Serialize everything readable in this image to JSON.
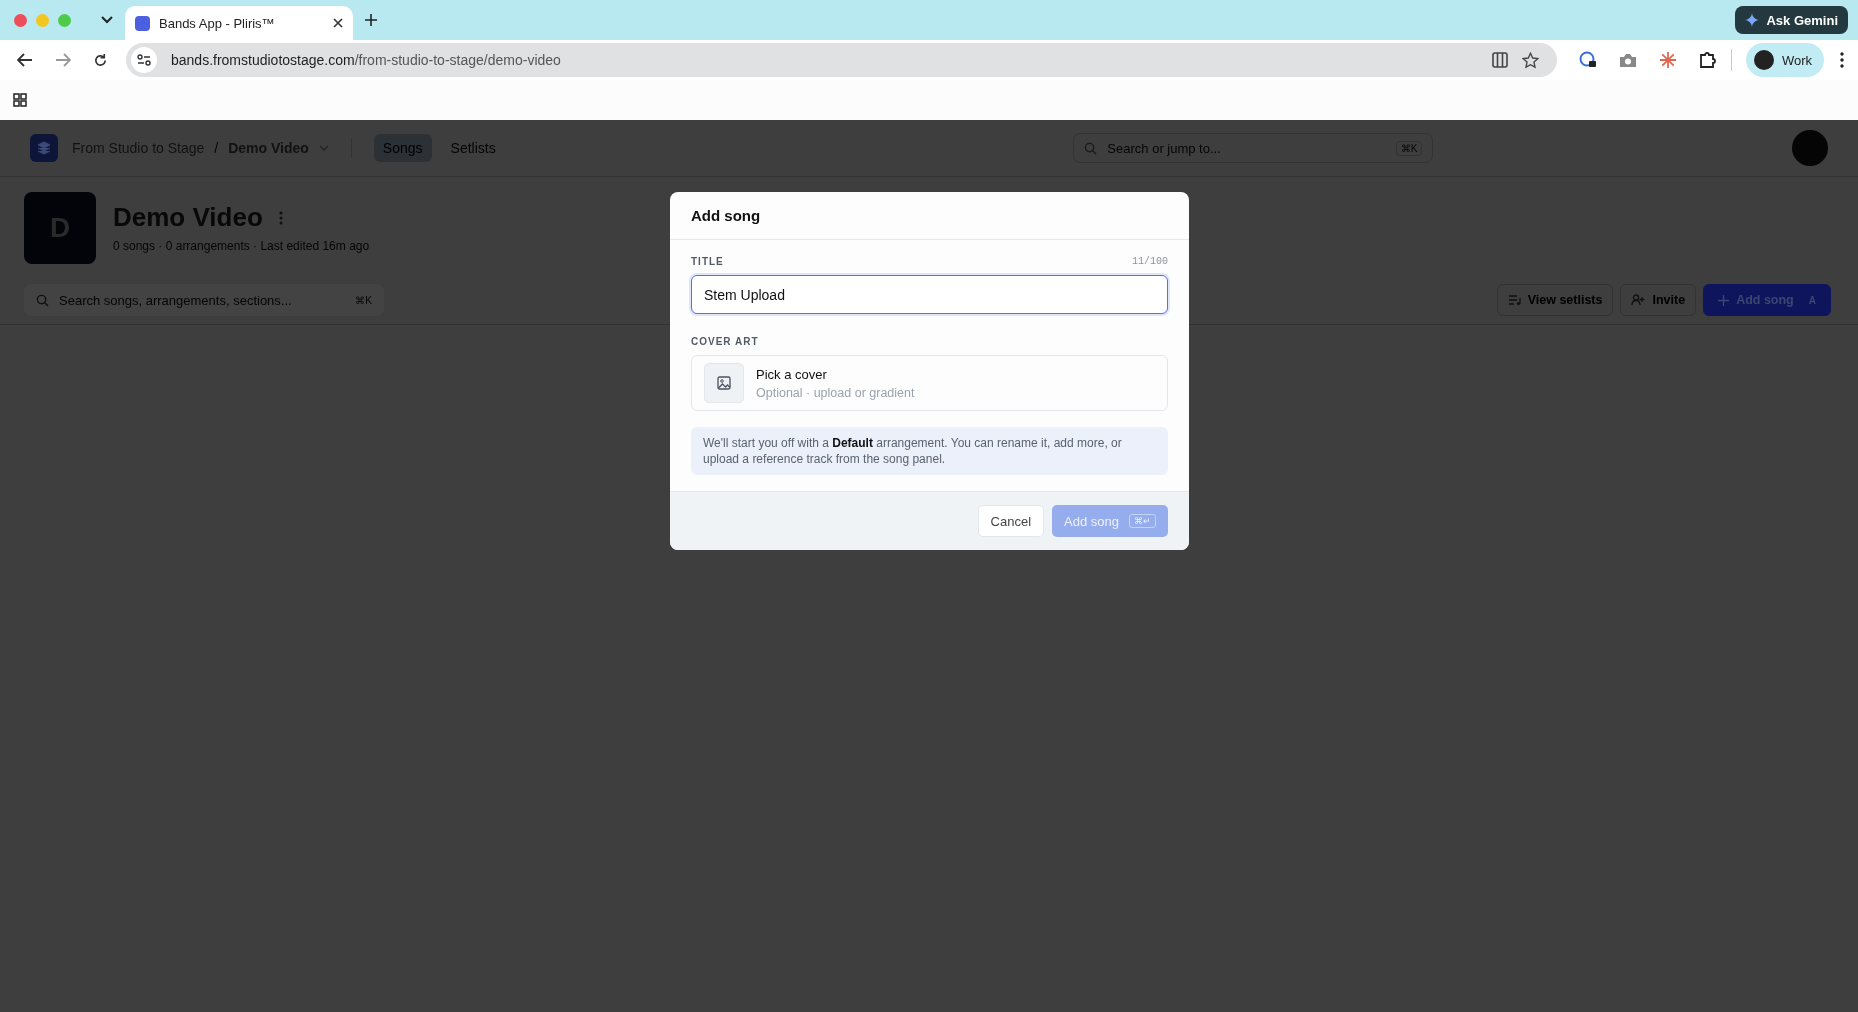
{
  "browser": {
    "tab": {
      "title": "Bands App - Pliris™",
      "selected": true
    },
    "url": {
      "host": "bands.fromstudiotostage.com",
      "path": "/from-studio-to-stage/demo-video"
    },
    "gemini": "Ask Gemini",
    "profile": "Work"
  },
  "app": {
    "breadcrumb": {
      "workspace": "From Studio to Stage",
      "separator": "/",
      "project": "Demo Video"
    },
    "nav": [
      {
        "label": "Songs",
        "selected": true
      },
      {
        "label": "Setlists",
        "selected": false
      }
    ],
    "global_search": {
      "placeholder": "Search or jump to...",
      "shortcut": "⌘K"
    },
    "project": {
      "avatar": "D",
      "title": "Demo Video",
      "meta": "0 songs · 0 arrangements · Last edited 16m ago"
    },
    "song_search": {
      "placeholder": "Search songs, arrangements, sections...",
      "shortcut": "⌘K"
    },
    "actions": [
      {
        "kind": "setlists",
        "label": "View setlists"
      },
      {
        "kind": "invite",
        "label": "Invite"
      },
      {
        "kind": "add",
        "label": "Add song",
        "shortcut": "A"
      }
    ]
  },
  "dialog": {
    "title": "Add song",
    "title_field": {
      "label": "TITLE",
      "counter": "11/100",
      "value": "Stem Upload"
    },
    "cover": {
      "label": "COVER ART",
      "title": "Pick a cover",
      "subtitle": "Optional · upload or gradient"
    },
    "note": "We'll start you off with a **Default** arrangement. You can rename it, add more, or upload a reference track from the song panel.",
    "cancel": "Cancel",
    "submit": {
      "label": "Add song",
      "shortcut": "⌘↵",
      "disabled": true
    }
  }
}
